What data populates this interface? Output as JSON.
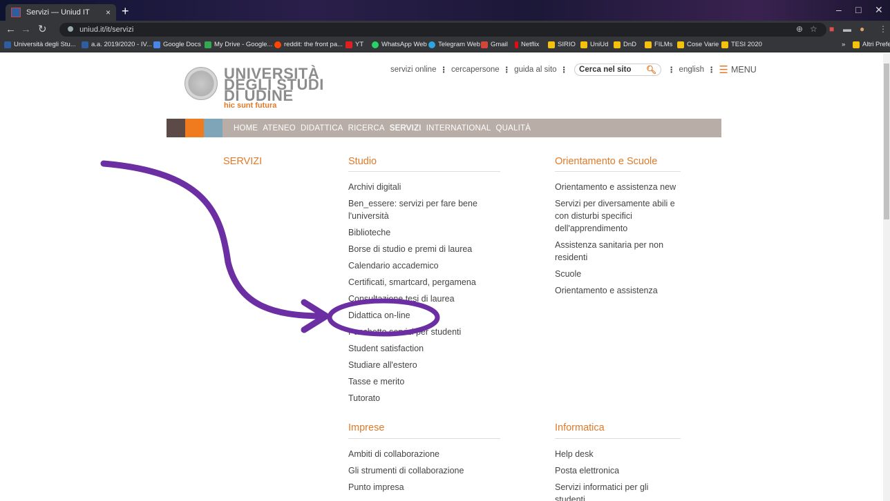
{
  "browser": {
    "tab_title": "Servizi — Uniud IT",
    "tab_close": "×",
    "new_tab": "+",
    "url": "uniud.it/it/servizi",
    "window_controls": [
      "–",
      "□",
      "✕"
    ],
    "bookmarks": [
      {
        "label": "Università degli Stu...",
        "color": "#2f5d9e"
      },
      {
        "label": "a.a. 2019/2020 - IV...",
        "color": "#2f5d9e"
      },
      {
        "label": "Google Docs",
        "color": "#4a86e8"
      },
      {
        "label": "My Drive - Google...",
        "color": "#34a853"
      },
      {
        "label": "reddit: the front pa...",
        "color": "#ff4500"
      },
      {
        "label": "YT",
        "color": "#e02020"
      },
      {
        "label": "WhatsApp Web",
        "color": "#25d366"
      },
      {
        "label": "Telegram Web",
        "color": "#2ca5e0"
      },
      {
        "label": "Gmail",
        "color": "#d44638"
      },
      {
        "label": "Netflix",
        "color": "#e50914"
      },
      {
        "label": "SIRIO",
        "color": "#f4c20d"
      },
      {
        "label": "UniUd",
        "color": "#f4c20d"
      },
      {
        "label": "DnD",
        "color": "#f4c20d"
      },
      {
        "label": "FILMs",
        "color": "#f4c20d"
      },
      {
        "label": "Cose Varie",
        "color": "#f4c20d"
      },
      {
        "label": "TESI 2020",
        "color": "#f4c20d"
      }
    ],
    "more_bookmarks": "»",
    "other_bookmarks": "Altri Preferiti"
  },
  "site": {
    "logo": {
      "line1": "UNIVERSITÀ",
      "line2": "DEGLI STUDI",
      "line3": "DI UDINE",
      "motto": "hic sunt futura"
    },
    "toplinks": {
      "servizi_online": "servizi online",
      "cercapersone": "cercapersone",
      "guida": "guida al sito",
      "search_placeholder": "Cerca nel sito",
      "english": "english",
      "menu": "MENU"
    },
    "nav_swatches": [
      "#5b4a45",
      "#f07a1e",
      "#7ea6b8"
    ],
    "nav": [
      "HOME",
      "ATENEO",
      "DIDATTICA",
      "RICERCA",
      "SERVIZI",
      "INTERNATIONAL",
      "QUALITÀ"
    ],
    "nav_active": "SERVIZI",
    "accent": "#e07a2a"
  },
  "content": {
    "servizi_title": "SERVIZI",
    "studio": {
      "title": "Studio",
      "items": [
        "Archivi digitali",
        "Ben_essere: servizi per fare bene l'università",
        "Biblioteche",
        "Borse di studio e premi di laurea",
        "Calendario accademico",
        "Certificati, smartcard, pergamena",
        "Consultazione tesi di laurea",
        "Didattica on-line",
        "Pacchetto servizi per studenti",
        "Student satisfaction",
        "Studiare all'estero",
        "Tasse e merito",
        "Tutorato"
      ]
    },
    "orientamento": {
      "title": "Orientamento e Scuole",
      "items": [
        "Orientamento e assistenza new",
        "Servizi per diversamente abili e con disturbi specifici dell'apprendimento",
        "Assistenza sanitaria per non residenti",
        "Scuole",
        "Orientamento e assistenza"
      ]
    },
    "imprese": {
      "title": "Imprese",
      "items": [
        "Ambiti di collaborazione",
        "Gli strumenti di collaborazione",
        "Punto impresa"
      ]
    },
    "informatica": {
      "title": "Informatica",
      "items": [
        "Help desk",
        "Posta elettronica",
        "Servizi informatici per gli studenti"
      ]
    }
  },
  "annotation": {
    "color": "#6b2fa3"
  }
}
